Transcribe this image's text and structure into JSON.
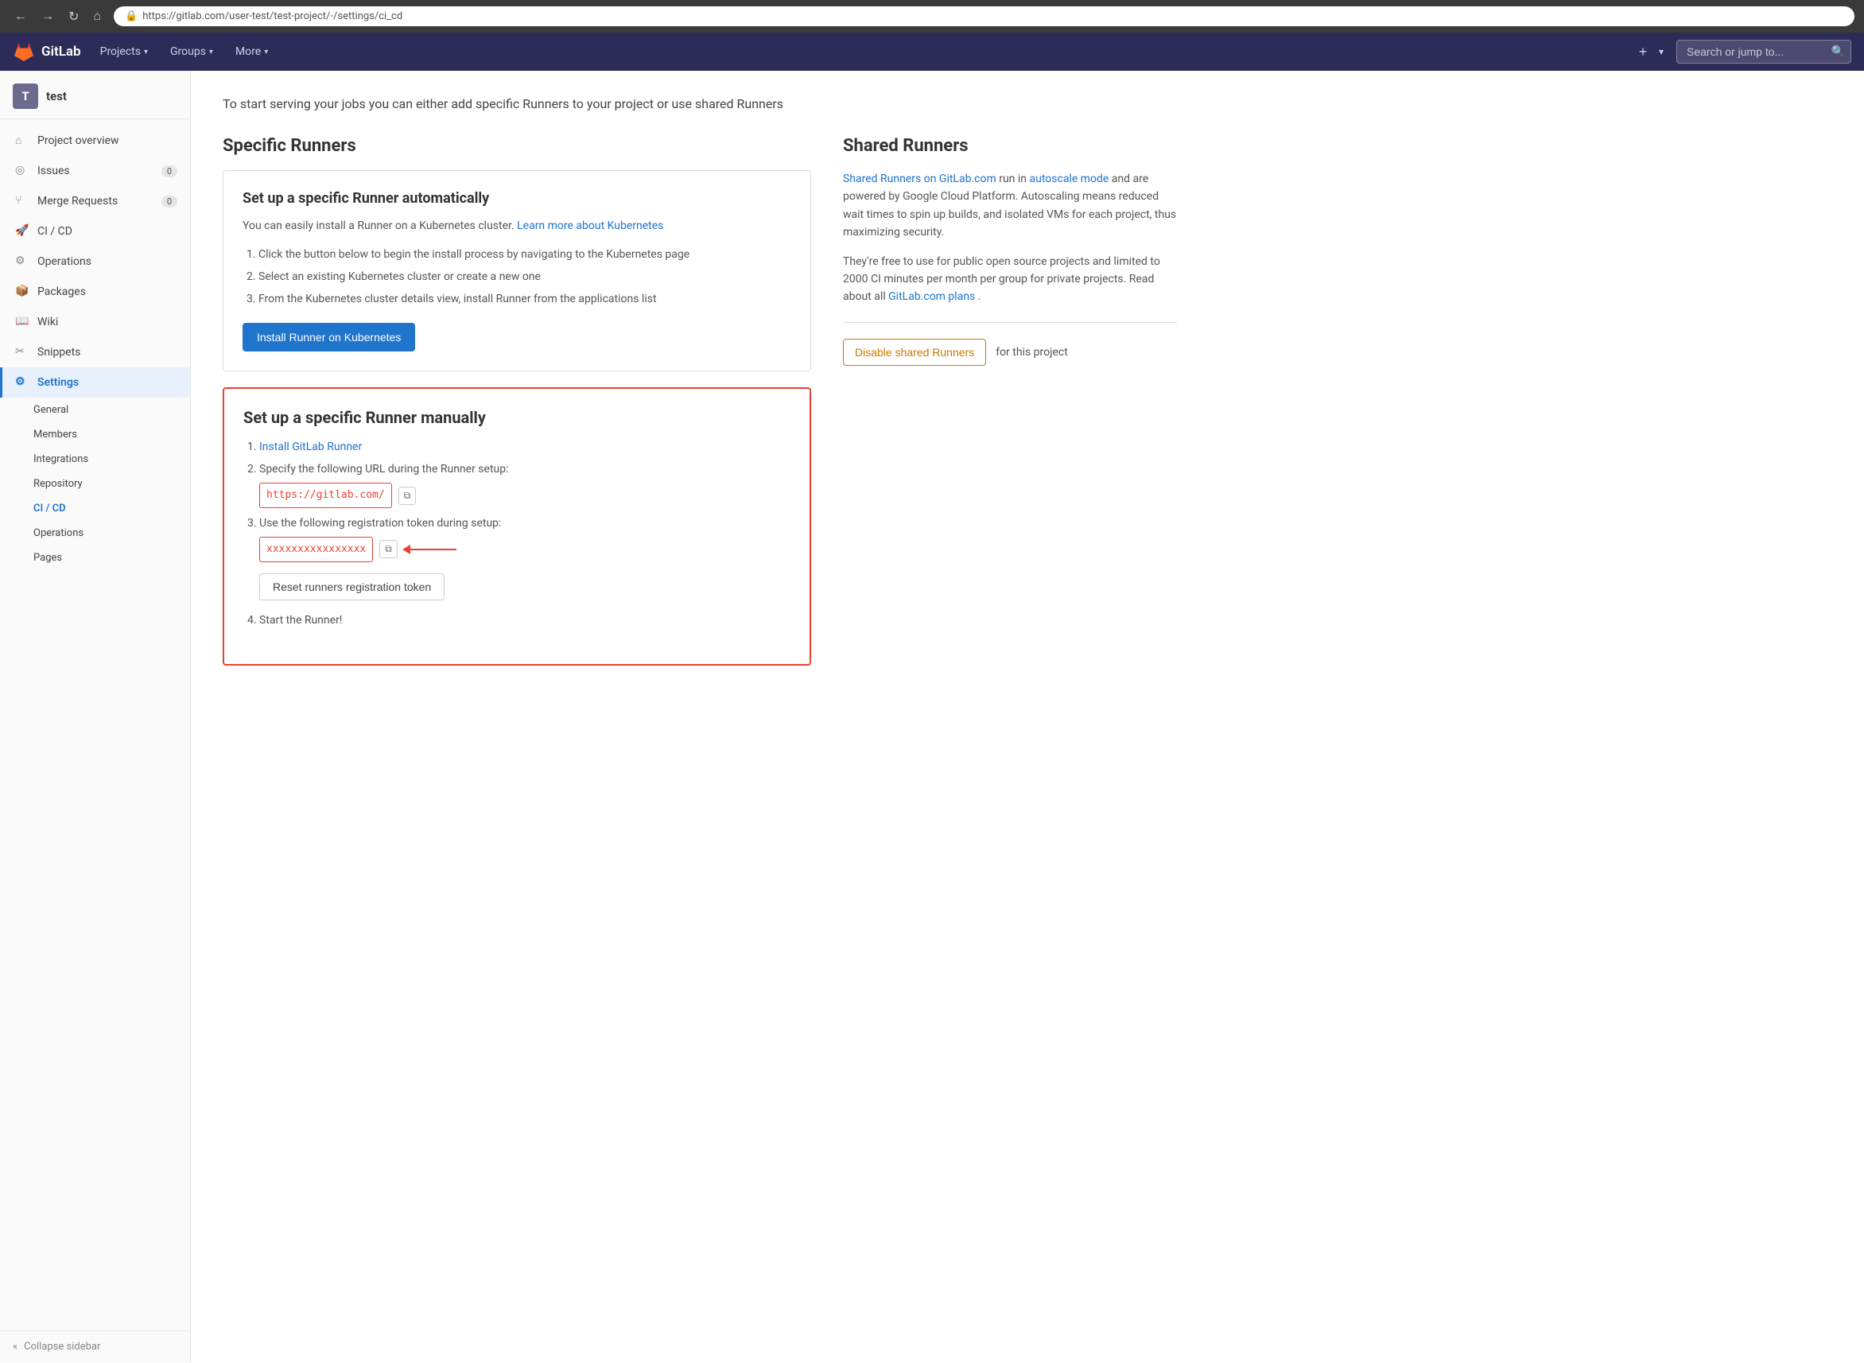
{
  "browser": {
    "url": "https://gitlab.com/user-test/test-project/-/settings/ci_cd",
    "back_title": "Back",
    "forward_title": "Forward",
    "refresh_title": "Refresh",
    "home_title": "Home"
  },
  "topnav": {
    "logo_text": "GitLab",
    "items": [
      {
        "label": "Projects",
        "has_chevron": true
      },
      {
        "label": "Groups",
        "has_chevron": true
      },
      {
        "label": "More",
        "has_chevron": true
      }
    ],
    "search_placeholder": "Search or jump to..."
  },
  "sidebar": {
    "project_initial": "T",
    "project_name": "test",
    "items": [
      {
        "id": "project-overview",
        "label": "Project overview",
        "icon": "house",
        "badge": null
      },
      {
        "id": "issues",
        "label": "Issues",
        "icon": "issue",
        "badge": "0"
      },
      {
        "id": "merge-requests",
        "label": "Merge Requests",
        "icon": "merge",
        "badge": "0"
      },
      {
        "id": "ci-cd",
        "label": "CI / CD",
        "icon": "rocket",
        "badge": null
      },
      {
        "id": "operations",
        "label": "Operations",
        "icon": "ops",
        "badge": null
      },
      {
        "id": "packages",
        "label": "Packages",
        "icon": "package",
        "badge": null
      },
      {
        "id": "wiki",
        "label": "Wiki",
        "icon": "wiki",
        "badge": null
      },
      {
        "id": "snippets",
        "label": "Snippets",
        "icon": "snippet",
        "badge": null
      },
      {
        "id": "settings",
        "label": "Settings",
        "icon": "settings",
        "badge": null,
        "active": true
      }
    ],
    "sub_items": [
      {
        "id": "general",
        "label": "General"
      },
      {
        "id": "members",
        "label": "Members"
      },
      {
        "id": "integrations",
        "label": "Integrations"
      },
      {
        "id": "repository",
        "label": "Repository"
      },
      {
        "id": "ci-cd-sub",
        "label": "CI / CD",
        "active": true
      },
      {
        "id": "operations-sub",
        "label": "Operations"
      },
      {
        "id": "pages",
        "label": "Pages"
      }
    ],
    "collapse_label": "Collapse sidebar"
  },
  "main": {
    "intro_text": "To start serving your jobs you can either add specific Runners to your project or use shared Runners",
    "specific_runners": {
      "section_title": "Specific Runners",
      "auto_card": {
        "title": "Set up a specific Runner automatically",
        "description": "You can easily install a Runner on a Kubernetes cluster.",
        "description_link_text": "Learn more about Kubernetes",
        "steps": [
          "Click the button below to begin the install process by navigating to the Kubernetes page",
          "Select an existing Kubernetes cluster or create a new one",
          "From the Kubernetes cluster details view, install Runner from the applications list"
        ],
        "button_label": "Install Runner on Kubernetes"
      },
      "manual_card": {
        "title": "Set up a specific Runner manually",
        "steps_prefix_1": "Install GitLab Runner",
        "step1_link": "Install GitLab Runner",
        "step2_text": "Specify the following URL during the Runner setup:",
        "url_value": "https://gitlab.com/",
        "step3_text": "Use the following registration token during setup:",
        "token_value": "xxxxxxxxxxxxxxxx",
        "reset_button_label": "Reset runners registration token",
        "step4_text": "Start the Runner!"
      }
    },
    "shared_runners": {
      "section_title": "Shared Runners",
      "para1_prefix": "",
      "para1_link1": "Shared Runners on GitLab.com",
      "para1_mid": " run in ",
      "para1_link2": "autoscale mode",
      "para1_suffix": " and are powered by Google Cloud Platform. Autoscaling means reduced wait times to spin up builds, and isolated VMs for each project, thus maximizing security.",
      "para2_prefix": "They're free to use for public open source projects and limited to 2000 CI minutes per month per group for private projects. Read about all ",
      "para2_link": "GitLab.com plans",
      "para2_suffix": ".",
      "disable_button_label": "Disable shared Runners",
      "disable_suffix_text": "for this project"
    }
  }
}
